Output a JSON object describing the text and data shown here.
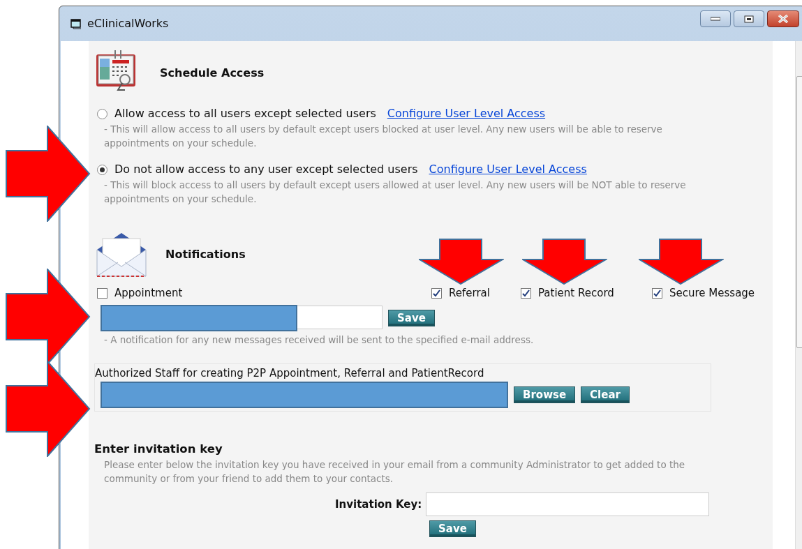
{
  "window": {
    "title": "eClinicalWorks"
  },
  "schedule_access": {
    "title": "Schedule Access",
    "options": [
      {
        "label": "Allow access to all users except selected users",
        "link": "Configure User Level Access",
        "description": "- This will allow access to all users by default except users blocked at user level. Any new users will be able to reserve appointments on your schedule.",
        "selected": false
      },
      {
        "label": "Do not allow access to any user except selected users",
        "link": "Configure User Level Access",
        "description": "- This will block access to all users by default except users allowed at user level. Any new users will be NOT able to reserve appointments on your schedule.",
        "selected": true
      }
    ]
  },
  "notifications": {
    "title": "Notifications",
    "checkboxes": [
      {
        "label": "Appointment",
        "checked": false
      },
      {
        "label": "Referral",
        "checked": true
      },
      {
        "label": "Patient Record",
        "checked": true
      },
      {
        "label": "Secure Message",
        "checked": true
      }
    ],
    "save_button": "Save",
    "note": "- A notification for any new messages received will be sent to the specified e-mail address."
  },
  "authorized_staff": {
    "label": "Authorized Staff for creating P2P Appointment, Referral and PatientRecord",
    "buttons": [
      "Browse",
      "Clear"
    ]
  },
  "invitation": {
    "title": "Enter invitation key",
    "description": "Please enter below the invitation key you have received in your email from a community Administrator to get added to the community or from your friend to add them to your contacts.",
    "field_label": "Invitation Key:",
    "save_button": "Save"
  }
}
